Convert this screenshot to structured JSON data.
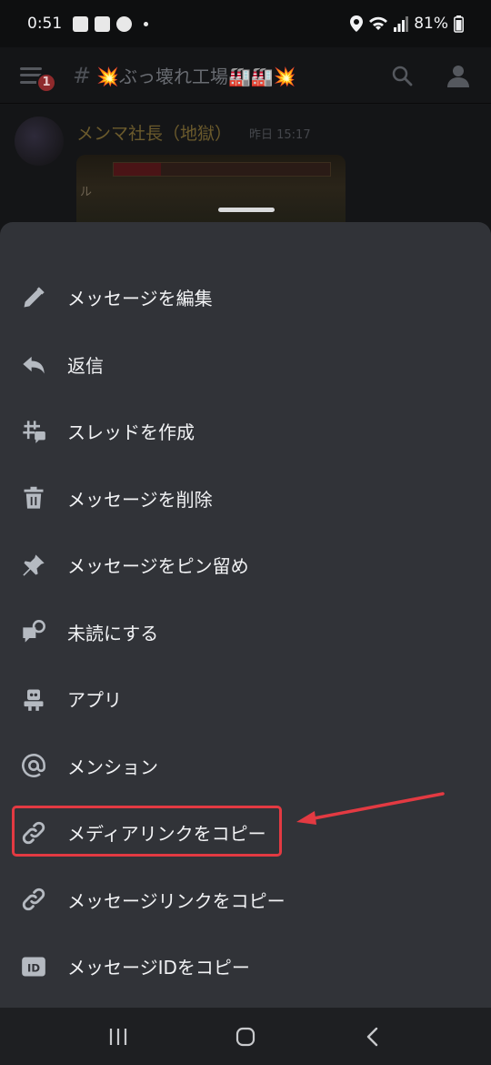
{
  "status_bar": {
    "time": "0:51",
    "battery": "81%"
  },
  "header": {
    "badge_count": "1",
    "channel_hash": "#",
    "channel_burst_left": "💥",
    "channel_title": "ぶっ壊れ工場",
    "channel_factory": "🏭🏭",
    "channel_burst_right": "💥"
  },
  "message": {
    "author": "メンマ社長（地獄）",
    "timestamp": "昨日 15:17",
    "attachment_text": "ル"
  },
  "menu": {
    "items": [
      {
        "label": "メッセージを編集",
        "icon": "pencil-icon"
      },
      {
        "label": "返信",
        "icon": "reply-icon"
      },
      {
        "label": "スレッドを作成",
        "icon": "thread-icon"
      },
      {
        "label": "メッセージを削除",
        "icon": "trash-icon"
      },
      {
        "label": "メッセージをピン留め",
        "icon": "pin-icon"
      },
      {
        "label": "未読にする",
        "icon": "mark-unread-icon"
      },
      {
        "label": "アプリ",
        "icon": "robot-icon"
      },
      {
        "label": "メンション",
        "icon": "at-icon"
      },
      {
        "label": "メディアリンクをコピー",
        "icon": "link-icon"
      },
      {
        "label": "メッセージリンクをコピー",
        "icon": "link-icon"
      },
      {
        "label": "メッセージIDをコピー",
        "icon": "id-icon"
      }
    ]
  },
  "annotation": {
    "highlight_color": "#e33a42"
  },
  "colors": {
    "sheet_bg": "#313338",
    "icon": "#b5bac1",
    "text": "#f2f3f5"
  }
}
